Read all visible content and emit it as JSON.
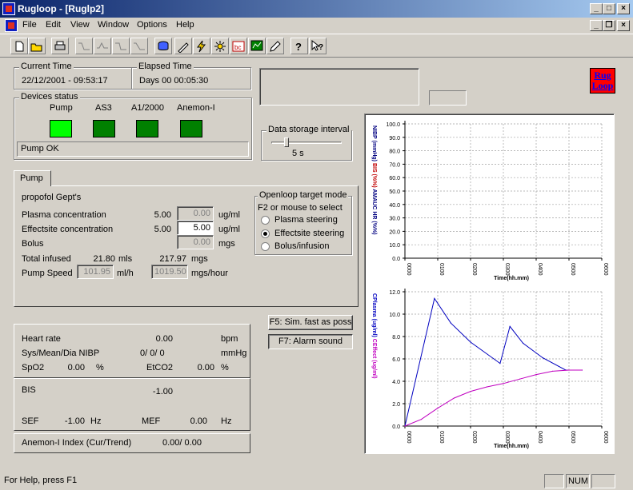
{
  "title": "Rugloop - [Ruglp2]",
  "menu": [
    "File",
    "Edit",
    "View",
    "Window",
    "Options",
    "Help"
  ],
  "toolbar_icons": [
    "new-file-icon",
    "open-folder-icon",
    "print-icon",
    "curve-1-icon",
    "curve-2-icon",
    "curve-3-icon",
    "curve-4-icon",
    "database-icon",
    "syringe-icon",
    "lightning-icon",
    "sun-icon",
    "bc-icon",
    "monitor-icon",
    "pen-icon",
    "help-icon",
    "context-help-icon"
  ],
  "time": {
    "current_label": "Current Time",
    "current_value": "22/12/2001 - 09:53:17",
    "elapsed_label": "Elapsed Time",
    "elapsed_value": "Days 00  00:05:30"
  },
  "logo": {
    "line1": "Rug",
    "line2": "Loop"
  },
  "devices": {
    "label": "Devices status",
    "items": [
      {
        "name": "Pump",
        "color": "#00ff00"
      },
      {
        "name": "AS3",
        "color": "#008000"
      },
      {
        "name": "A1/2000",
        "color": "#008000"
      },
      {
        "name": "Anemon-I",
        "color": "#008000"
      }
    ],
    "status": "Pump OK"
  },
  "storage": {
    "label": "Data storage interval",
    "value": "5 s",
    "fraction": 0.2
  },
  "pump": {
    "tab": "Pump",
    "drug": "propofol Gept's",
    "plasma_label": "Plasma concentration",
    "plasma_value": "5.00",
    "plasma_target": "0.00",
    "plasma_unit": "ug/ml",
    "effect_label": "Effectsite concentration",
    "effect_value": "5.00",
    "effect_target": "5.00",
    "effect_unit": "ug/ml",
    "bolus_label": "Bolus",
    "bolus_target": "0.00",
    "bolus_unit": "mgs",
    "total_label": "Total infused",
    "total_mls": "21.80",
    "total_mls_unit": "mls",
    "total_mgs": "217.97",
    "total_mgs_unit": "mgs",
    "speed_label": "Pump Speed",
    "speed_mlh": "101.95",
    "speed_mlh_unit": "ml/h",
    "speed_mgs": "1019.50",
    "speed_mgs_unit": "mgs/hour"
  },
  "mode": {
    "label": "Openloop target mode",
    "hint": "F2 or mouse to select",
    "options": [
      {
        "label": "Plasma steering",
        "selected": false
      },
      {
        "label": "Effectsite steering",
        "selected": true
      },
      {
        "label": "Bolus/infusion",
        "selected": false
      }
    ]
  },
  "buttons": {
    "sim": "F5: Sim. fast as poss",
    "alarm": "F7: Alarm sound"
  },
  "vitals": {
    "hr_label": "Heart rate",
    "hr_value": "0.00",
    "hr_unit": "bpm",
    "nibp_label": "Sys/Mean/Dia NIBP",
    "nibp_value": "0/  0/  0",
    "nibp_unit": "mmHg",
    "spo2_label": "SpO2",
    "spo2_value": "0.00",
    "spo2_unit": "%",
    "etco2_label": "EtCO2",
    "etco2_value": "0.00",
    "etco2_unit": "%",
    "bis_label": "BIS",
    "bis_value": "-1.00",
    "sef_label": "SEF",
    "sef_value": "-1.00",
    "sef_unit": "Hz",
    "mef_label": "MEF",
    "mef_value": "0.00",
    "mef_unit": "Hz",
    "anemon_label": "Anemon-I Index (Cur/Trend)",
    "anemon_value": "0.00/   0.00"
  },
  "statusbar": {
    "help": "For Help, press F1",
    "num": "NUM"
  },
  "chart_data": [
    {
      "type": "line",
      "ylabel_parts": [
        "NIBP (mmHg)",
        "BIS (%%)",
        "AMAUC HR (%%)"
      ],
      "ylabel_colors": [
        "#000080",
        "#c00000",
        "#000080"
      ],
      "xlabel": "Time(hh.mm)",
      "ylim": [
        0,
        100
      ],
      "yticks": [
        "0.0",
        "10.0",
        "20.0",
        "30.0",
        "40.0",
        "50.0",
        "60.0",
        "70.0",
        "80.0",
        "90.0",
        "100.0"
      ],
      "xticks": [
        "0000",
        "0100",
        "0200",
        "0300",
        "0400",
        "0500",
        "0600"
      ],
      "xlim": [
        0,
        6
      ],
      "grid": true,
      "series": []
    },
    {
      "type": "line",
      "ylabel_parts": [
        "CPlasma (ug/ml)",
        "CEffect (ug/ml)"
      ],
      "ylabel_colors": [
        "#0000c0",
        "#c000c0"
      ],
      "xlabel": "Time(hh.mm)",
      "ylim": [
        0,
        12
      ],
      "yticks": [
        "0.0",
        "2.0",
        "4.0",
        "6.0",
        "8.0",
        "10.0",
        "12.0"
      ],
      "xticks": [
        "0000",
        "0100",
        "0200",
        "0300",
        "0400",
        "0500",
        "0600"
      ],
      "xlim": [
        0,
        6
      ],
      "grid": true,
      "series": [
        {
          "color": "#0000c0",
          "points": [
            [
              0,
              0
            ],
            [
              0.9,
              11.4
            ],
            [
              1.4,
              9.2
            ],
            [
              2.0,
              7.5
            ],
            [
              2.9,
              5.6
            ],
            [
              3.2,
              8.9
            ],
            [
              3.6,
              7.4
            ],
            [
              4.2,
              6.1
            ],
            [
              4.9,
              5.0
            ],
            [
              5.4,
              5.0
            ]
          ]
        },
        {
          "color": "#c000c0",
          "points": [
            [
              0,
              0
            ],
            [
              0.5,
              0.6
            ],
            [
              1.0,
              1.6
            ],
            [
              1.5,
              2.5
            ],
            [
              2.0,
              3.1
            ],
            [
              2.5,
              3.5
            ],
            [
              3.0,
              3.8
            ],
            [
              3.5,
              4.2
            ],
            [
              4.0,
              4.6
            ],
            [
              4.5,
              4.9
            ],
            [
              5.0,
              5.0
            ],
            [
              5.4,
              5.0
            ]
          ]
        }
      ]
    }
  ]
}
